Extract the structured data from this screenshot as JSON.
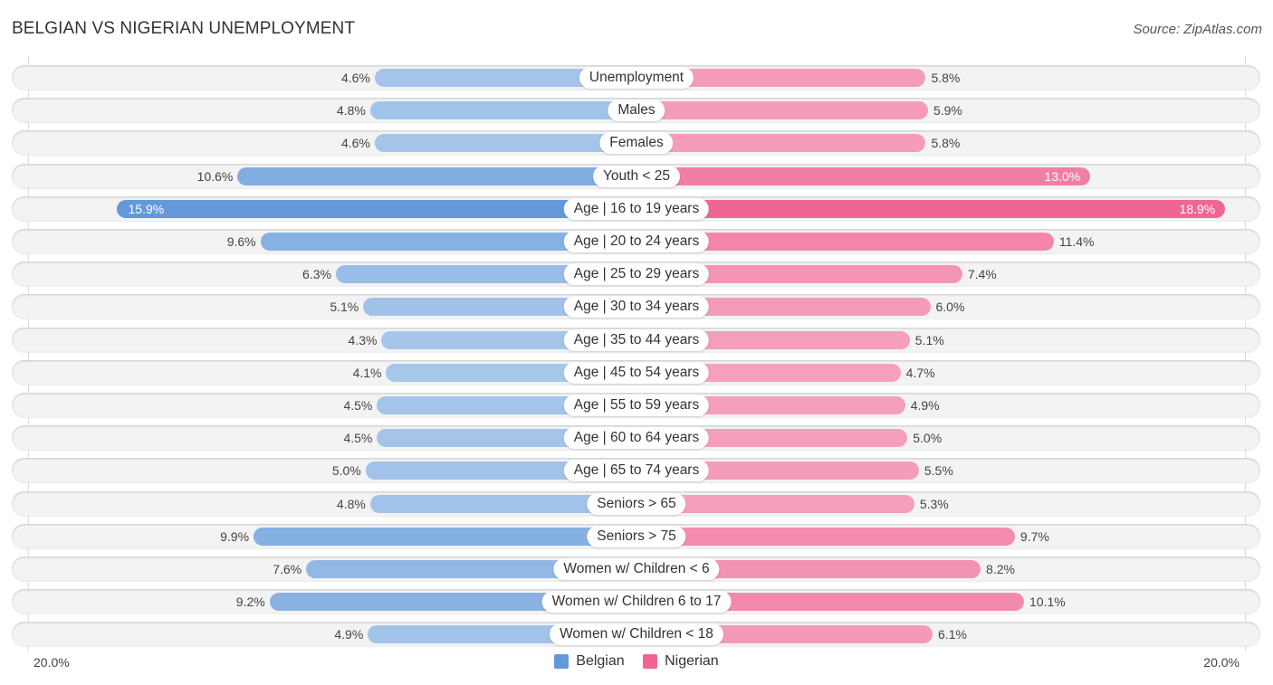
{
  "title": "BELGIAN VS NIGERIAN UNEMPLOYMENT",
  "source": "Source: ZipAtlas.com",
  "colors": {
    "belgian_strong": "#6399d9",
    "belgian_light": "#a7c6ea",
    "nigerian_strong": "#f06693",
    "nigerian_light": "#f5a3be"
  },
  "chart_data": {
    "type": "bar",
    "orientation": "horizontal-diverging",
    "title": "BELGIAN VS NIGERIAN UNEMPLOYMENT",
    "xlabel": "",
    "ylabel": "",
    "xlim": [
      0,
      20.0
    ],
    "axis_labels": {
      "left": "20.0%",
      "right": "20.0%"
    },
    "legend": {
      "position": "bottom-center",
      "entries": [
        "Belgian",
        "Nigerian"
      ]
    },
    "categories": [
      "Unemployment",
      "Males",
      "Females",
      "Youth < 25",
      "Age | 16 to 19 years",
      "Age | 20 to 24 years",
      "Age | 25 to 29 years",
      "Age | 30 to 34 years",
      "Age | 35 to 44 years",
      "Age | 45 to 54 years",
      "Age | 55 to 59 years",
      "Age | 60 to 64 years",
      "Age | 65 to 74 years",
      "Seniors > 65",
      "Seniors > 75",
      "Women w/ Children < 6",
      "Women w/ Children 6 to 17",
      "Women w/ Children < 18"
    ],
    "series": [
      {
        "name": "Belgian",
        "values": [
          4.6,
          4.8,
          4.6,
          10.6,
          15.9,
          9.6,
          6.3,
          5.1,
          4.3,
          4.1,
          4.5,
          4.5,
          5.0,
          4.8,
          9.9,
          7.6,
          9.2,
          4.9
        ]
      },
      {
        "name": "Nigerian",
        "values": [
          5.8,
          5.9,
          5.8,
          13.0,
          18.9,
          11.4,
          7.4,
          6.0,
          5.1,
          4.7,
          4.9,
          5.0,
          5.5,
          5.3,
          9.7,
          8.2,
          10.1,
          6.1
        ]
      }
    ]
  }
}
